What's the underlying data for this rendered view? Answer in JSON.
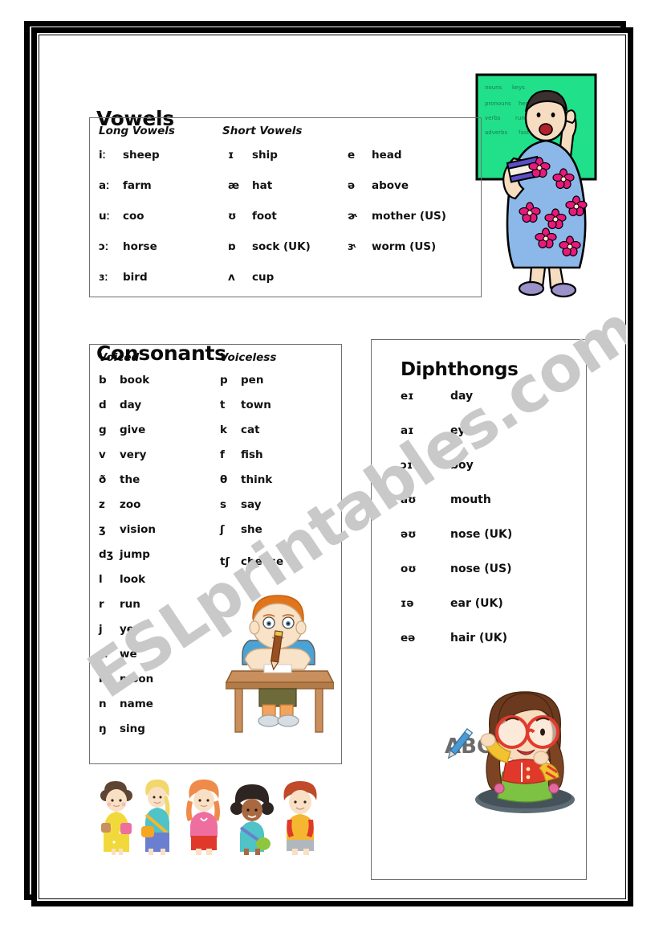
{
  "watermark": {
    "text": "ESLprintables.com"
  },
  "sections": {
    "vowels": {
      "title": "Vowels",
      "columns": {
        "long": "Long Vowels",
        "short": "Short Vowels"
      },
      "long_vowels": [
        {
          "symbol": "iː",
          "word": "sheep"
        },
        {
          "symbol": "aː",
          "word": "farm"
        },
        {
          "symbol": "uː",
          "word": "coo"
        },
        {
          "symbol": "ɔː",
          "word": "horse"
        },
        {
          "symbol": "ɜː",
          "word": "bird"
        }
      ],
      "short_vowels_col1": [
        {
          "symbol": "ɪ",
          "word": "ship"
        },
        {
          "symbol": "æ",
          "word": "hat"
        },
        {
          "symbol": "ʊ",
          "word": "foot"
        },
        {
          "symbol": "ɒ",
          "word": "sock (UK)"
        },
        {
          "symbol": "ʌ",
          "word": "cup"
        }
      ],
      "short_vowels_col2": [
        {
          "symbol": "e",
          "word": "head"
        },
        {
          "symbol": "ə",
          "word": "above"
        },
        {
          "symbol": "ɚ",
          "word": "mother (US)"
        },
        {
          "symbol": "ɝ",
          "word": "worm (US)"
        }
      ]
    },
    "consonants": {
      "title": "Consonants",
      "columns": {
        "voiced": "Voiced",
        "voiceless": "Voiceless"
      },
      "voiced": [
        {
          "symbol": "b",
          "word": "book"
        },
        {
          "symbol": "d",
          "word": "day"
        },
        {
          "symbol": "g",
          "word": "give"
        },
        {
          "symbol": "v",
          "word": "very"
        },
        {
          "symbol": "ð",
          "word": "the"
        },
        {
          "symbol": "z",
          "word": "zoo"
        },
        {
          "symbol": "ʒ",
          "word": "vision"
        },
        {
          "symbol": "dʒ",
          "word": "jump"
        },
        {
          "symbol": "l",
          "word": "look"
        },
        {
          "symbol": "r",
          "word": "run"
        },
        {
          "symbol": "j",
          "word": "yes"
        },
        {
          "symbol": "w",
          "word": "we"
        },
        {
          "symbol": "m",
          "word": "moon"
        },
        {
          "symbol": "n",
          "word": "name"
        },
        {
          "symbol": "ŋ",
          "word": "sing"
        }
      ],
      "voiceless": [
        {
          "symbol": "p",
          "word": "pen"
        },
        {
          "symbol": "t",
          "word": "town"
        },
        {
          "symbol": "k",
          "word": "cat"
        },
        {
          "symbol": "f",
          "word": "fish"
        },
        {
          "symbol": "θ",
          "word": "think"
        },
        {
          "symbol": "s",
          "word": "say"
        },
        {
          "symbol": "ʃ",
          "word": "she"
        },
        {
          "symbol": "tʃ",
          "word": "cheese"
        }
      ]
    },
    "diphthongs": {
      "title": "Diphthongs",
      "entries": [
        {
          "symbol": "eɪ",
          "word": "day"
        },
        {
          "symbol": "aɪ",
          "word": "eye"
        },
        {
          "symbol": "ɔɪ",
          "word": "boy"
        },
        {
          "symbol": "aʊ",
          "word": "mouth"
        },
        {
          "symbol": "əʊ",
          "word": "nose (UK)"
        },
        {
          "symbol": "oʊ",
          "word": "nose (US)"
        },
        {
          "symbol": "ɪə",
          "word": "ear (UK)"
        },
        {
          "symbol": "eə",
          "word": "hair (UK)"
        }
      ]
    }
  },
  "illustrations": {
    "teacher": {
      "name": "teacher-at-blackboard",
      "board_lines": [
        "nouns",
        "pronouns",
        "verbs",
        "adverbs"
      ],
      "colors": {
        "board": "#21e08a",
        "dress": "#8bb8e8",
        "flower": "#e8197d",
        "skin": "#f6dcc0",
        "hair": "#3a3030",
        "shoe": "#9a92c8"
      }
    },
    "boy": {
      "name": "boy-writing-at-desk",
      "colors": {
        "hair": "#e2741c",
        "skin": "#f8e2c8",
        "shirt": "#4aa3d6",
        "desk": "#c98f5c",
        "pencil": "#9a4f22",
        "pants": "#6e6a3a"
      }
    },
    "girl": {
      "name": "girl-with-glasses-writing-abc",
      "abc_text": "ABC",
      "colors": {
        "hair": "#6b3a1e",
        "skin": "#f7dcbe",
        "glasses": "#e23b2e",
        "vest": "#e0392b",
        "skirt": "#7dc242",
        "pencil": "#4a9bd4"
      }
    },
    "children": {
      "name": "five-children-with-backpacks",
      "colors": {
        "c1": "#f2d93b",
        "c2": "#4fc3c7",
        "c3": "#ef6ea0",
        "c4": "#3fb6a8",
        "c5": "#f5b730"
      }
    }
  }
}
